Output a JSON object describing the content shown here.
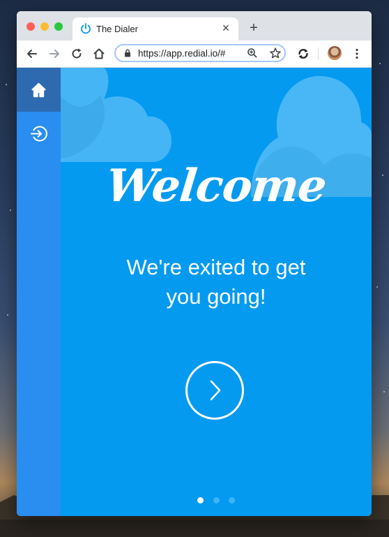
{
  "browser": {
    "tab_title": "The Dialer",
    "new_tab_label": "+",
    "close_label": "×",
    "url": "https://app.redial.io/#"
  },
  "sidebar": {
    "items": [
      {
        "icon": "home-icon",
        "active": true
      },
      {
        "icon": "sign-in-icon",
        "active": false
      }
    ]
  },
  "main": {
    "title": "Welcome",
    "subtitle_line1": "We're exited to get",
    "subtitle_line2": "you going!",
    "next_icon": "chevron-right-icon",
    "pagination": {
      "total": 3,
      "current": 1
    }
  },
  "colors": {
    "content_bg": "#039af0",
    "sidebar_bg": "#2a8df0",
    "sidebar_active": "#2d6ab0",
    "cloud": "#4db8f5"
  }
}
